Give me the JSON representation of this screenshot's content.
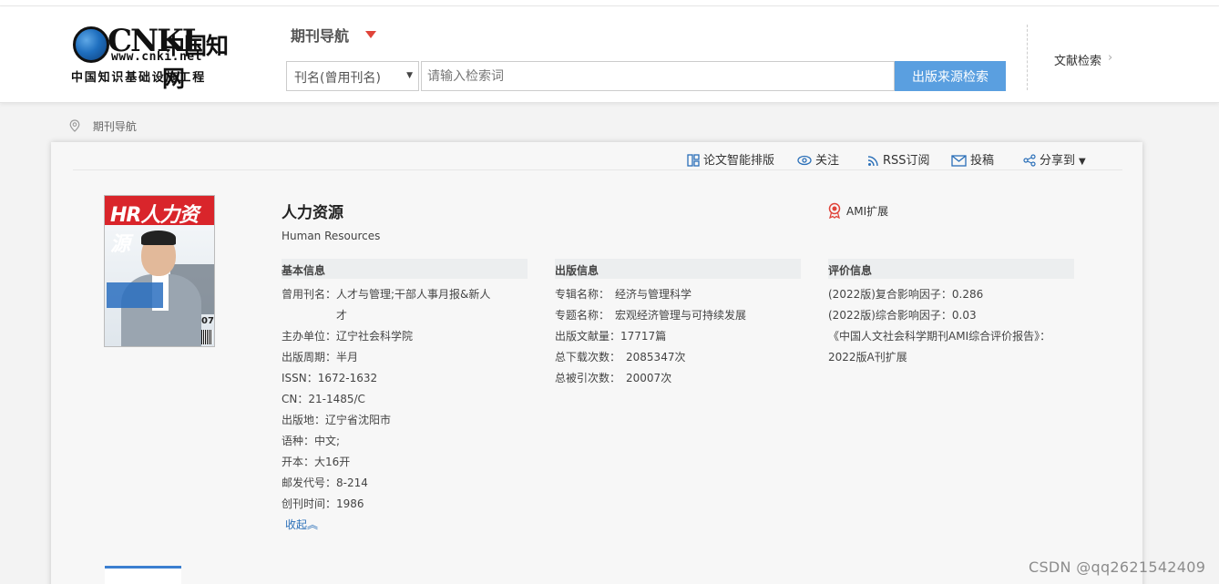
{
  "logo": {
    "brand": "CNKI",
    "brand_cn": "中国知网",
    "url": "www.cnki.net",
    "sub": "中国知识基础设施工程"
  },
  "header": {
    "nav_label": "期刊导航",
    "search_field_selected": "刊名(曾用刊名)",
    "search_placeholder": "请输入检索词",
    "search_button": "出版来源检索",
    "literature_search": "文献检索"
  },
  "breadcrumb": {
    "current": "期刊导航"
  },
  "toolbar": {
    "layout": "论文智能排版",
    "follow": "关注",
    "rss": "RSS订阅",
    "submit": "投稿",
    "share": "分享到"
  },
  "journal": {
    "title": "人力资源",
    "title_en": "Human Resources",
    "badge": "AMI扩展",
    "cover": {
      "masthead": "HR人力资源",
      "issue": "07"
    }
  },
  "basic_info": {
    "heading": "基本信息",
    "rows": [
      {
        "k": "曾用刊名：",
        "v": "人才与管理;干部人事月报&新人才"
      },
      {
        "k": "主办单位：",
        "v": "辽宁社会科学院"
      },
      {
        "k": "出版周期：",
        "v": "半月"
      },
      {
        "k": "ISSN：",
        "v": "1672-1632"
      },
      {
        "k": "CN：",
        "v": "21-1485/C"
      },
      {
        "k": "出版地：",
        "v": "辽宁省沈阳市"
      },
      {
        "k": "语种：",
        "v": "中文;"
      },
      {
        "k": "开本：",
        "v": "大16开"
      },
      {
        "k": "邮发代号：",
        "v": "8-214"
      },
      {
        "k": "创刊时间：",
        "v": "1986"
      }
    ],
    "collapse": "收起︽"
  },
  "pub_info": {
    "heading": "出版信息",
    "rows": [
      {
        "k": "专辑名称：",
        "v": "经济与管理科学"
      },
      {
        "k": "专题名称：",
        "v": "宏观经济管理与可持续发展"
      },
      {
        "k": "出版文献量：",
        "v": "17717篇"
      },
      {
        "k": "总下载次数：",
        "v": "2085347次"
      },
      {
        "k": "总被引次数：",
        "v": "20007次"
      }
    ]
  },
  "eval_info": {
    "heading": "评价信息",
    "rows": [
      {
        "k": "(2022版)复合影响因子：",
        "v": "0.286"
      },
      {
        "k": "(2022版)综合影响因子：",
        "v": "0.03"
      },
      {
        "k": "《中国人文社会科学期刊AMI综合评价报告》：",
        "v": ""
      },
      {
        "k": "",
        "v": "2022版A刊扩展"
      }
    ]
  },
  "watermark": "CSDN @qq2621542409",
  "colors": {
    "accent": "#5a9fe0",
    "nav_arrow": "#e0443a",
    "link": "#2a6fb8"
  }
}
